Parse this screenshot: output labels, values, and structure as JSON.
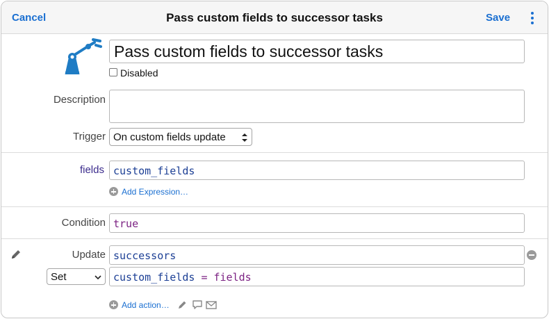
{
  "header": {
    "cancel_label": "Cancel",
    "title": "Pass custom fields to successor tasks",
    "save_label": "Save",
    "more_icon": "vertical-ellipsis-icon"
  },
  "rule": {
    "icon": "robot-arm-icon",
    "name": "Pass custom fields to successor tasks",
    "disabled_label": "Disabled",
    "disabled_checked": false,
    "description_label": "Description",
    "description_value": "",
    "trigger_label": "Trigger",
    "trigger_value": "On custom fields update"
  },
  "expressions": {
    "variable_name": "fields",
    "variable_value": "custom_fields",
    "add_expression_label": "Add Expression…"
  },
  "condition": {
    "label": "Condition",
    "value": "true"
  },
  "action": {
    "edit_icon": "pencil-icon",
    "update_label": "Update",
    "update_target": "successors",
    "mode_value": "Set",
    "assignment_left": "custom_fields",
    "assignment_op": "=",
    "assignment_right": "fields",
    "remove_icon": "minus-circle-icon",
    "add_action_label": "Add action…",
    "extra_icons": [
      "pencil-icon",
      "comment-icon",
      "mail-icon"
    ]
  },
  "colors": {
    "accent": "#1a6fd1",
    "robot": "#1f7cc4",
    "variable": "#1c3f95",
    "keyword": "#7c2283"
  }
}
